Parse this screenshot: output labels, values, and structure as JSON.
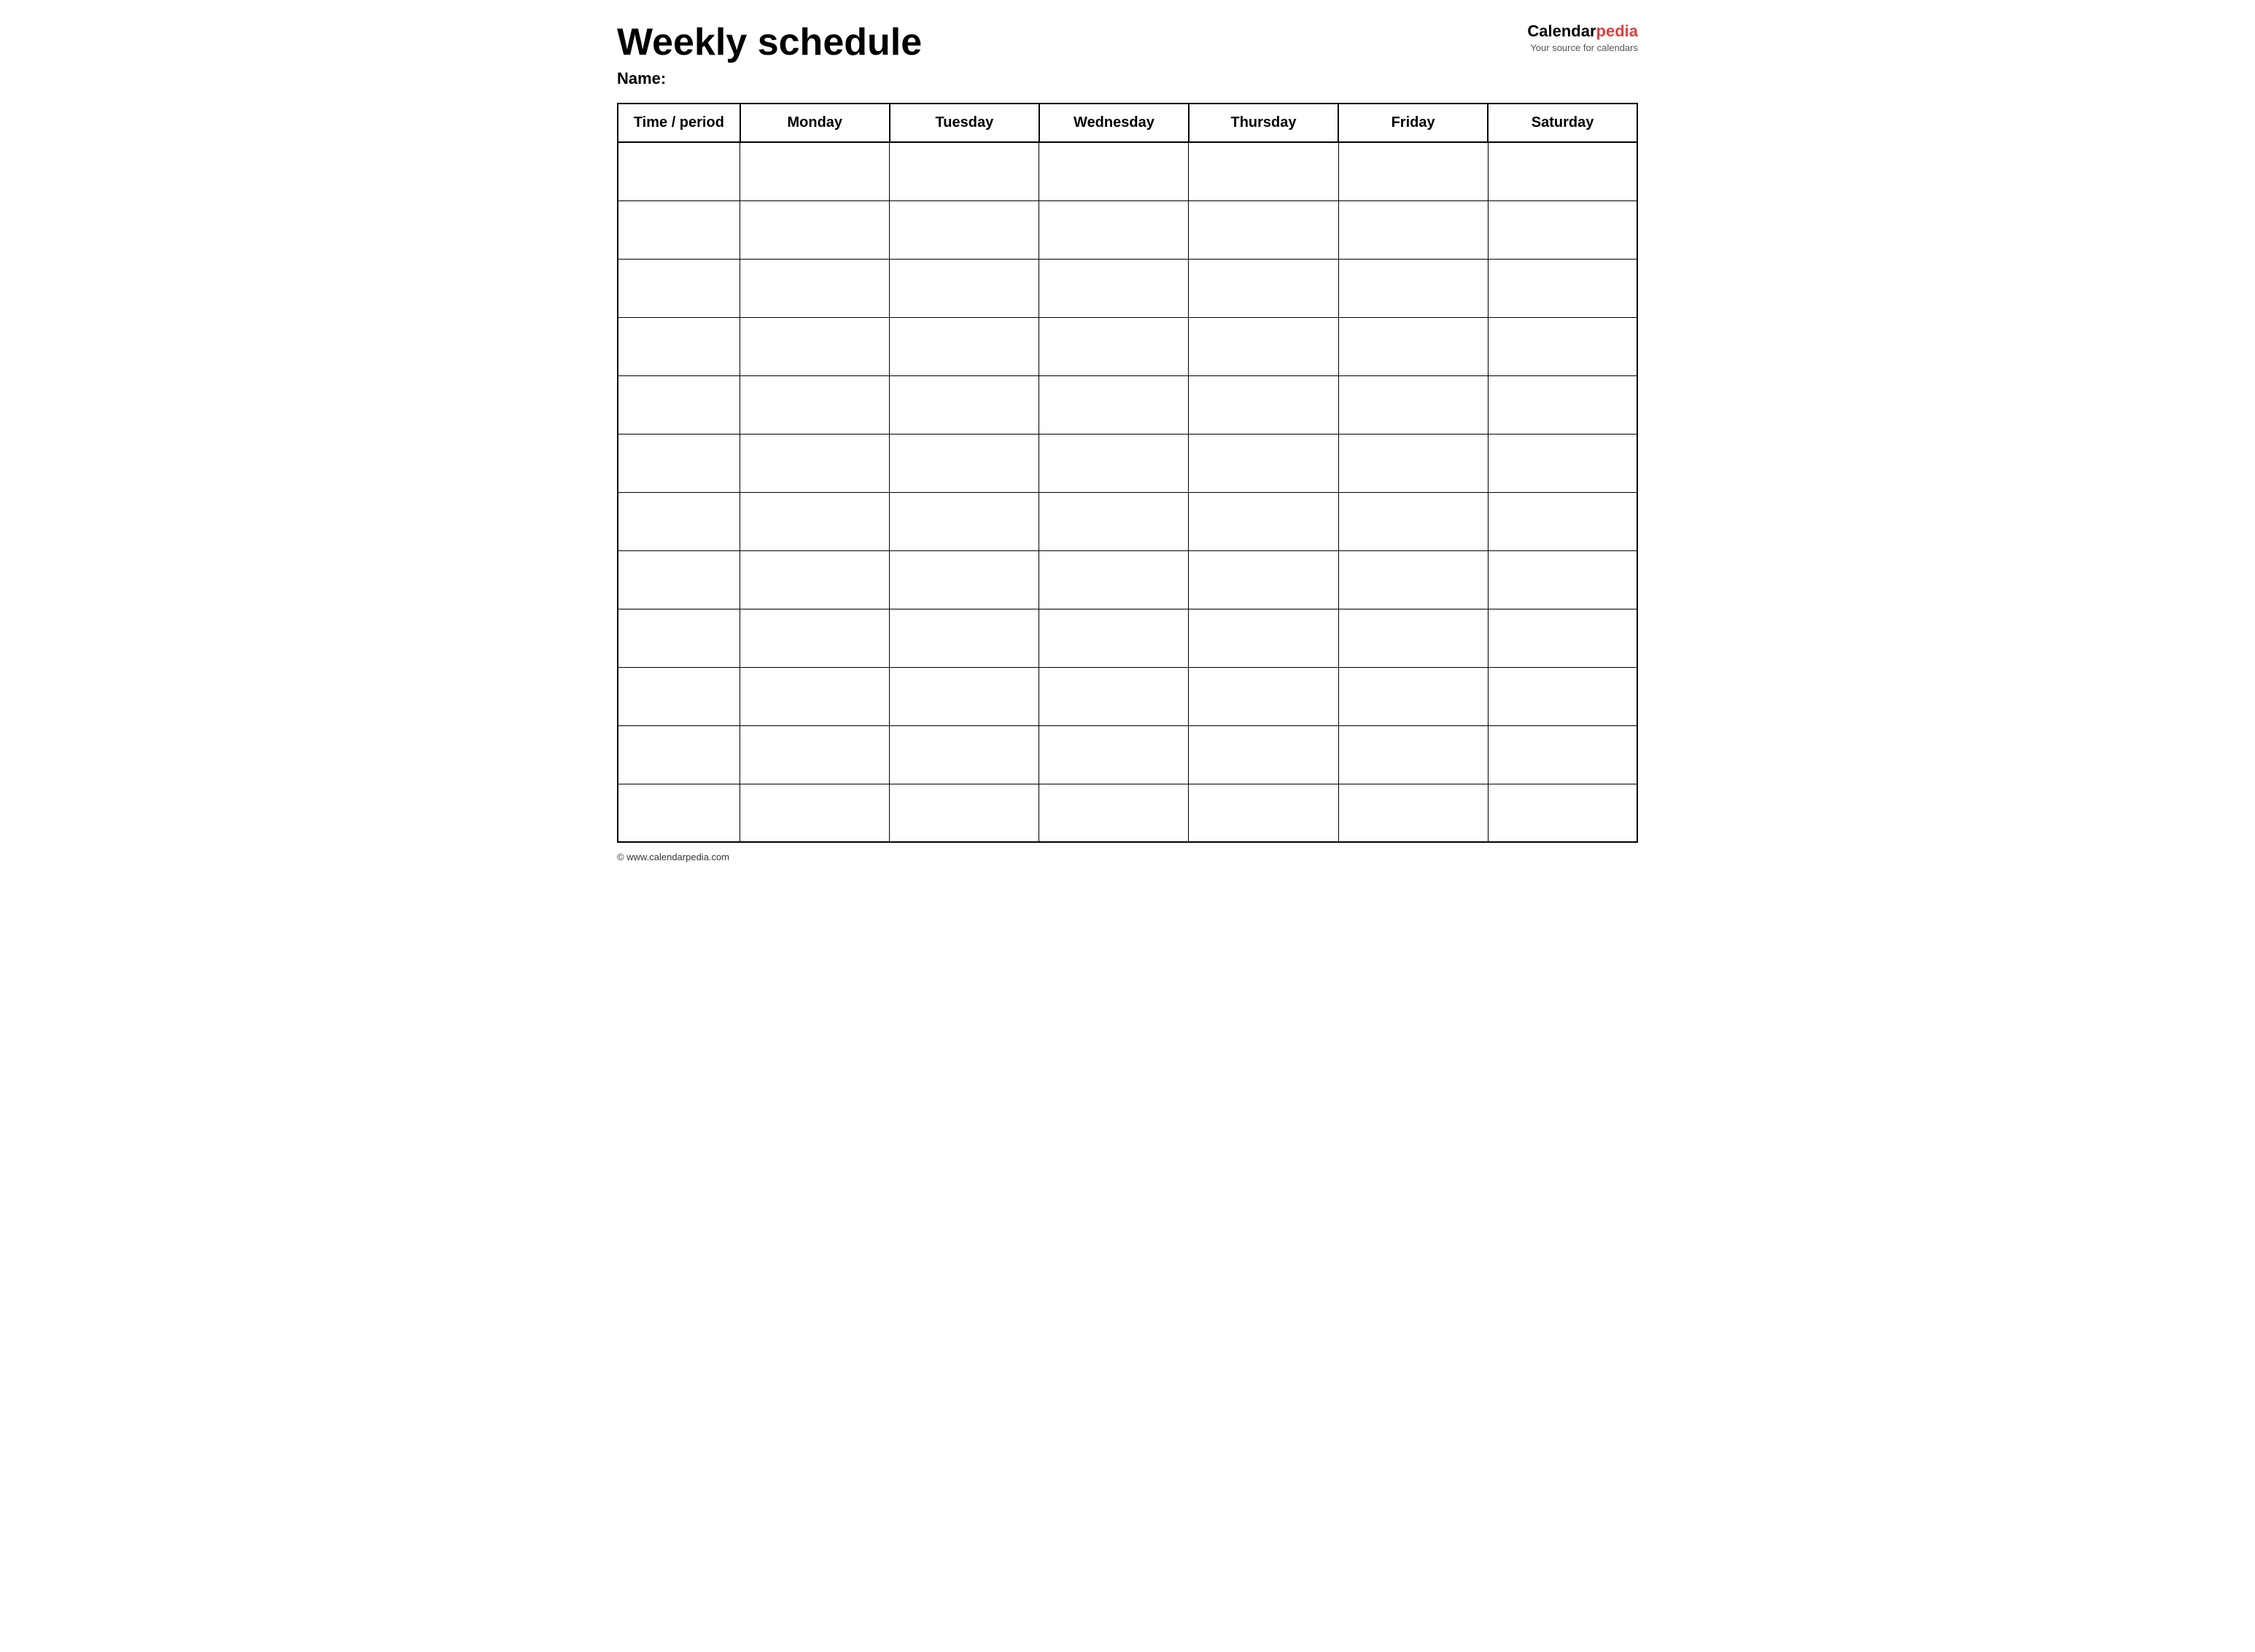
{
  "header": {
    "title": "Weekly schedule",
    "name_label": "Name:",
    "logo_calendar": "Calendar",
    "logo_pedia": "pedia",
    "logo_tagline": "Your source for calendars"
  },
  "table": {
    "columns": [
      {
        "key": "time",
        "label": "Time / period"
      },
      {
        "key": "monday",
        "label": "Monday"
      },
      {
        "key": "tuesday",
        "label": "Tuesday"
      },
      {
        "key": "wednesday",
        "label": "Wednesday"
      },
      {
        "key": "thursday",
        "label": "Thursday"
      },
      {
        "key": "friday",
        "label": "Friday"
      },
      {
        "key": "saturday",
        "label": "Saturday"
      }
    ],
    "row_count": 12
  },
  "footer": {
    "url": "© www.calendarpedia.com"
  }
}
